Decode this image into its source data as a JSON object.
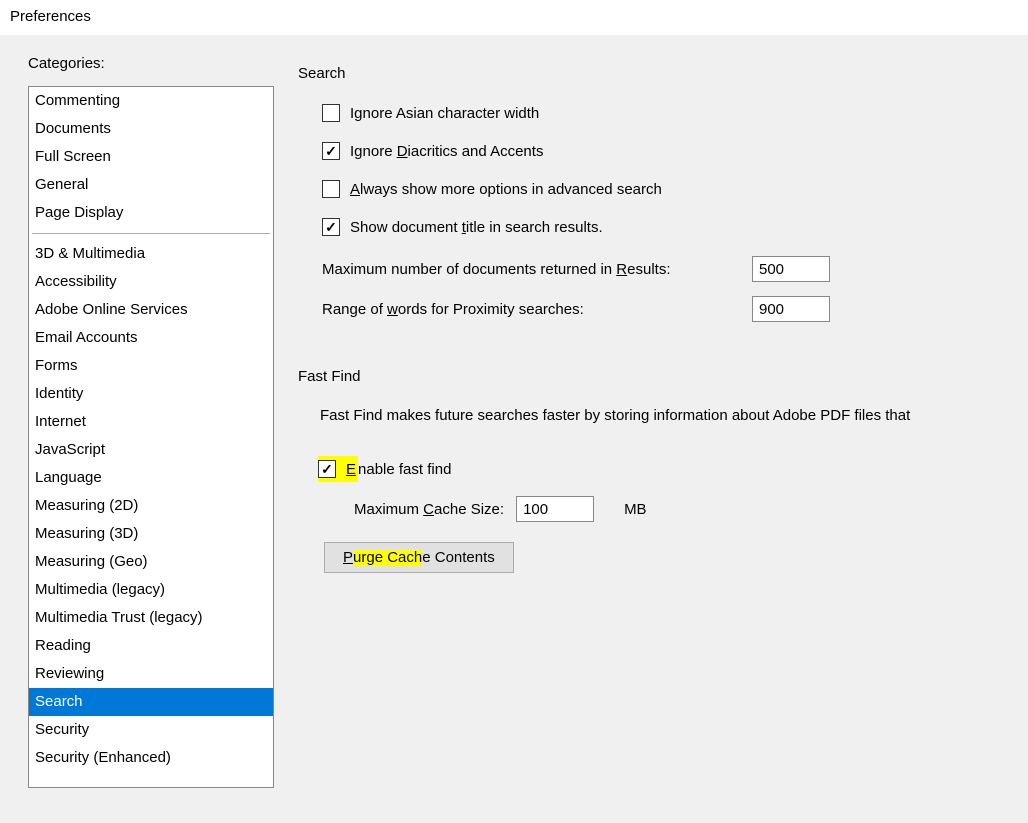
{
  "window": {
    "title": "Preferences"
  },
  "sidebar": {
    "heading": "Categories:",
    "group1": [
      "Commenting",
      "Documents",
      "Full Screen",
      "General",
      "Page Display"
    ],
    "group2": [
      "3D & Multimedia",
      "Accessibility",
      "Adobe Online Services",
      "Email Accounts",
      "Forms",
      "Identity",
      "Internet",
      "JavaScript",
      "Language",
      "Measuring (2D)",
      "Measuring (3D)",
      "Measuring (Geo)",
      "Multimedia (legacy)",
      "Multimedia Trust (legacy)",
      "Reading",
      "Reviewing",
      "Search",
      "Security",
      "Security (Enhanced)"
    ],
    "selected": "Search"
  },
  "search_group": {
    "title": "Search",
    "ignore_asian": {
      "label": "Ignore Asian character width",
      "checked": false
    },
    "ignore_diacritics": {
      "label_pre": "Ignore ",
      "label_u": "D",
      "label_post": "iacritics and Accents",
      "checked": true
    },
    "always_more": {
      "label_u": "A",
      "label_post": "lways show more options in advanced search",
      "checked": false
    },
    "show_title": {
      "label_pre": "Show document ",
      "label_u": "t",
      "label_post": "itle in search results.",
      "checked": true
    },
    "max_docs": {
      "label_pre": "Maximum number of documents returned in ",
      "label_u": "R",
      "label_post": "esults:",
      "value": "500"
    },
    "range_words": {
      "label_pre": "Range of ",
      "label_u": "w",
      "label_post": "ords for Proximity searches:",
      "value": "900"
    }
  },
  "fastfind_group": {
    "title": "Fast Find",
    "description": "Fast Find makes future searches faster by storing information about Adobe PDF files that",
    "enable": {
      "label_u": "E",
      "label_post": "nable fast find",
      "checked": true
    },
    "cache": {
      "label_pre": "Maximum ",
      "label_u": "C",
      "label_post": "ache Size:",
      "value": "100",
      "unit": "MB"
    },
    "purge": {
      "label_u": "P",
      "label_hl": "urge Cach",
      "label_post": "e Contents"
    }
  }
}
